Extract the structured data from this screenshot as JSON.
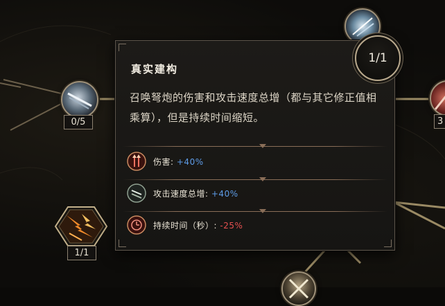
{
  "nodes": {
    "left_node_count": "0/5",
    "hex_node_count": "1/1",
    "right_node_count": "3"
  },
  "tooltip": {
    "title": "真实建构",
    "description": "召唤弩炮的伤害和攻击速度总增（都与其它修正值相乘算），但是持续时间缩短。",
    "level": "1/1",
    "stats": [
      {
        "label": "伤害",
        "value": "+40%",
        "icon": "damage-icon",
        "color": "#5d9be6"
      },
      {
        "label": "攻击速度总增",
        "value": "+40%",
        "icon": "attack-speed-icon",
        "color": "#5d9be6"
      },
      {
        "label": "持续时间（秒）",
        "value": "-25%",
        "icon": "duration-icon",
        "color": "#e65050"
      }
    ]
  }
}
